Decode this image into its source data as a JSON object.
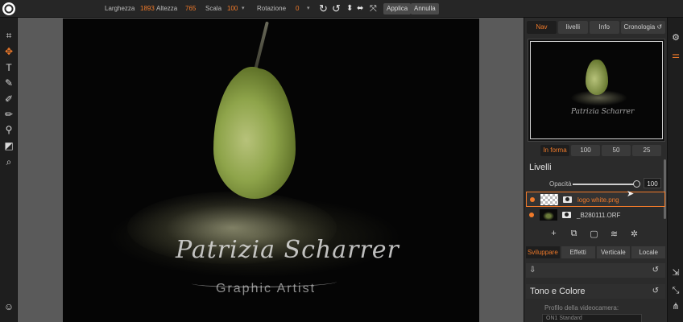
{
  "toolbar": {
    "width_label": "Larghezza",
    "width_value": "1893",
    "height_label": "Altezza",
    "height_value": "765",
    "scale_label": "Scala",
    "scale_value": "100",
    "rotation_label": "Rotazione",
    "rotation_value": "0",
    "apply_label": "Applica",
    "cancel_label": "Annulla"
  },
  "tools": [
    "crop-icon",
    "move-icon",
    "text-icon",
    "brush-icon",
    "retouch-icon",
    "mask-brush-icon",
    "refine-brush-icon",
    "eraser-icon",
    "zoom-icon",
    "user-icon"
  ],
  "canvas": {
    "signature_text": "Patrizia Scharrer",
    "subtitle_text": "Graphic Artist"
  },
  "panel": {
    "tabs": [
      "Nav",
      "livelli",
      "Info",
      "Cronologia"
    ],
    "active_tab": "Nav",
    "nav_signature": "Patrizia Scharrer",
    "zoom_options": [
      "In forma",
      "100",
      "50",
      "25"
    ],
    "layers_title": "Livelli",
    "opacity_label": "Opacità",
    "opacity_value": "100",
    "opacity_fraction": 1.0,
    "layers": [
      {
        "name": "logo white.png",
        "selected": true
      },
      {
        "name": "_B280111.ORF",
        "selected": false
      }
    ],
    "develop_tabs": [
      "Sviluppare",
      "Effetti",
      "Verticale",
      "Locale"
    ],
    "tone_title": "Tono e Colore",
    "camera_label": "Profilo della videocamera:",
    "camera_value": "ON1 Standard"
  },
  "colors": {
    "accent": "#f07a2a",
    "panel_bg": "#2b2b2b",
    "canvas_bg": "#5a5a5a"
  }
}
